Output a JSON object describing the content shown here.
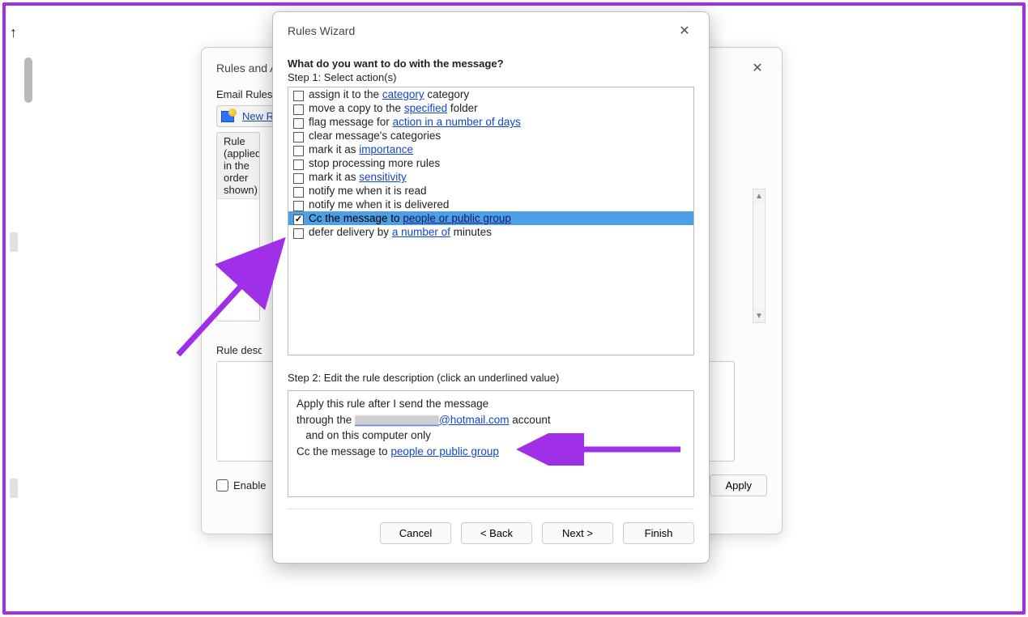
{
  "back_dialog": {
    "title": "Rules and Alerts",
    "email_rules_label": "Email Rules",
    "new_rule_label": "New Rule...",
    "grid_header": "Rule (applied in the order shown)",
    "rule_desc_label": "Rule description (click an underlined value to edit):",
    "enable_label": "Enable rules on all messages downloaded from RSS Feeds",
    "apply_btn": "Apply"
  },
  "front_dialog": {
    "title": "Rules Wizard",
    "question": "What do you want to do with the message?",
    "step1_label": "Step 1: Select action(s)",
    "actions": [
      {
        "checked": false,
        "pre": "assign it to the ",
        "link": "category",
        "post": " category"
      },
      {
        "checked": false,
        "pre": "move a copy to the ",
        "link": "specified",
        "post": " folder"
      },
      {
        "checked": false,
        "pre": "flag message for ",
        "link": "action in a number of days",
        "post": ""
      },
      {
        "checked": false,
        "pre": "clear message's categories",
        "link": "",
        "post": ""
      },
      {
        "checked": false,
        "pre": "mark it as ",
        "link": "importance",
        "post": ""
      },
      {
        "checked": false,
        "pre": "stop processing more rules",
        "link": "",
        "post": ""
      },
      {
        "checked": false,
        "pre": "mark it as ",
        "link": "sensitivity",
        "post": ""
      },
      {
        "checked": false,
        "pre": "notify me when it is read",
        "link": "",
        "post": ""
      },
      {
        "checked": false,
        "pre": "notify me when it is delivered",
        "link": "",
        "post": ""
      },
      {
        "checked": true,
        "pre": "Cc the message to ",
        "link": "people or public group",
        "post": "",
        "selected": true
      },
      {
        "checked": false,
        "pre": "defer delivery by ",
        "link": "a number of",
        "post": " minutes"
      }
    ],
    "step2_label": "Step 2: Edit the rule description (click an underlined value)",
    "desc": {
      "line1": "Apply this rule after I send the message",
      "line2_pre": "through the ",
      "line2_link_suffix": "@hotmail.com",
      "line2_post": " account",
      "line3": "   and on this computer only",
      "line4_pre": "Cc the message to ",
      "line4_link": "people or public group"
    },
    "buttons": {
      "cancel": "Cancel",
      "back": "< Back",
      "next": "Next >",
      "finish": "Finish"
    }
  }
}
